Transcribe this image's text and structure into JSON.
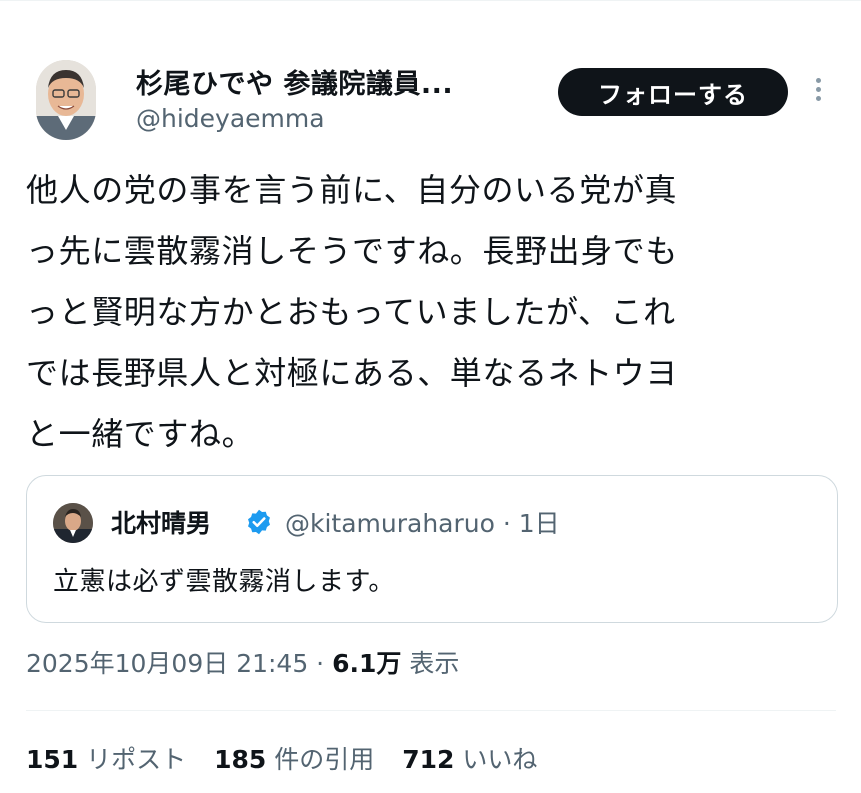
{
  "author": {
    "display_name": "杉尾ひでや 参議院議員...",
    "handle": "@hideyaemma",
    "follow_label": "フォローする"
  },
  "tweet": {
    "lines": [
      "他人の党の事を言う前に、自分のいる党が真",
      "っ先に雲散霧消しそうですね。長野出身でも",
      "っと賢明な方かとおもっていましたが、これ",
      "では長野県人と対極にある、単なるネトウヨ",
      "と一緒ですね。"
    ]
  },
  "quoted": {
    "display_name": "北村晴男",
    "handle_time": "@kitamuraharuo · 1日",
    "text": "立憲は必ず雲散霧消します。"
  },
  "meta": {
    "datetime": "2025年10月09日 21:45 · ",
    "views": "6.1万",
    "views_label": " 表示"
  },
  "stats": {
    "reposts": "151",
    "reposts_label": " リポスト",
    "quotes": "185",
    "quotes_label": " 件の引用",
    "likes": "712",
    "likes_label": " いいね"
  },
  "icons": {
    "more": "more-vertical-icon",
    "verified": "verified-badge-icon"
  },
  "colors": {
    "text": "#0f1419",
    "secondary": "#536471",
    "verified": "#1d9bf0",
    "button": "#0f1419",
    "border": "#cfd9de"
  }
}
